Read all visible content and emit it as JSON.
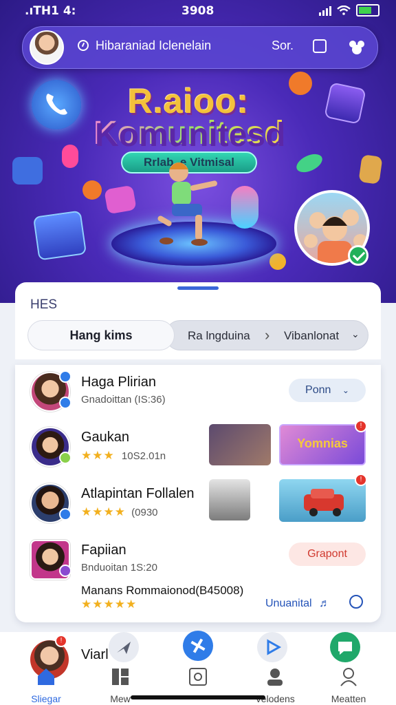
{
  "status_bar": {
    "left": ".ıTH1 4:",
    "center": "3908"
  },
  "search": {
    "text": "Hibaraniad Iclenelain",
    "sort_label": "Sor."
  },
  "hero": {
    "title_line1": "R.aioo:",
    "title_line2": "Komunitesd",
    "ribbon": "Rrlab_e Vitmisal"
  },
  "sheet": {
    "title": "HES",
    "filter_left": "Hang kims",
    "filter_right_a": "Ra lngduina",
    "filter_right_b": "Vibanlonat"
  },
  "list": [
    {
      "name": "Haga Plirian",
      "sub": "Gnadoittan (IS:36)",
      "action": "Ponn"
    },
    {
      "name": "Gaukan",
      "stars": "★★★",
      "sub": "10S2.01n",
      "thumb_text": "Yomnias"
    },
    {
      "name": "Atlapintan Follalen",
      "stars": "★★★★",
      "sub": "(0930"
    },
    {
      "name": "Fapiian",
      "sub": "Bnduoitan 1S:20",
      "action": "Grapont"
    }
  ],
  "footer_line": "Manans Rommaionod(B45008)",
  "footer_stars": "★★★★★",
  "footer_link": "Unuanital",
  "peek_name": "Viarl",
  "nav": [
    {
      "label": "Sliegar"
    },
    {
      "label": "Mew"
    },
    {
      "label": ""
    },
    {
      "label": "Velodens"
    },
    {
      "label": "Meatten"
    }
  ],
  "colors": {
    "accent": "#2f6ae0",
    "hero_purple": "#4a2ab8",
    "star": "#f2b01e",
    "notif": "#e5342b"
  }
}
